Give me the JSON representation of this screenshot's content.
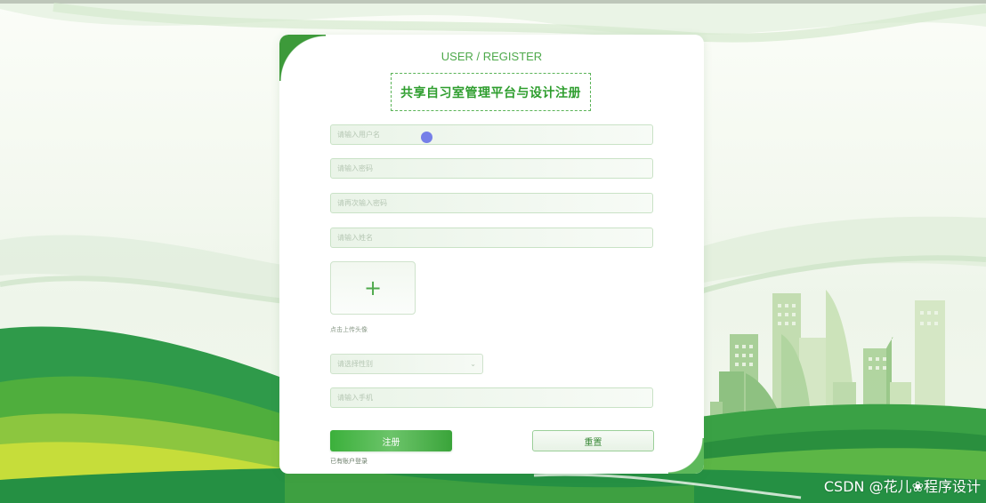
{
  "window": {
    "subtitle": "USER / REGISTER",
    "title": "共享自习室管理平台与设计注册"
  },
  "form": {
    "username_placeholder": "请输入用户名",
    "password_placeholder": "请输入密码",
    "confirm_password_placeholder": "请再次输入密码",
    "name_placeholder": "请输入姓名",
    "avatar_upload_icon": "plus-icon",
    "avatar_upload_glyph": "+",
    "avatar_hint": "点击上传头像",
    "gender_select_placeholder": "请选择性别",
    "gender_select_icon": "chevron-down-icon",
    "phone_placeholder": "请输入手机",
    "register_label": "注册",
    "reset_label": "重置",
    "login_link": "已有账户登录"
  },
  "watermark": "CSDN @花儿❀程序设计",
  "colors": {
    "brand_green": "#3bb03b",
    "title_green": "#2f9e2f",
    "cursor": "#6f78e8"
  }
}
